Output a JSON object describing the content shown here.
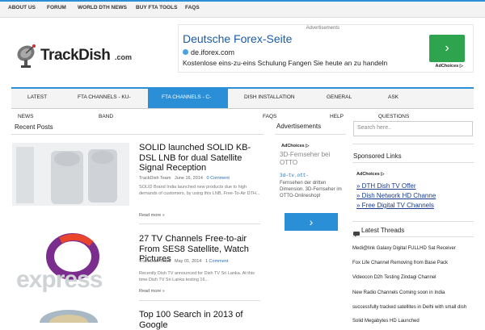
{
  "topnav": [
    "ABOUT US",
    "FORUM",
    "WORLD DTH NEWS",
    "BUY FTA TOOLS",
    "FAQS"
  ],
  "logo": {
    "name": "TrackDish",
    "suffix": ".com"
  },
  "top_ad": {
    "label": "Advertisements",
    "headline": "Deutsche Forex-Seite",
    "url": "de.iforex.com",
    "description": "Kostenlose eins-zu-eins Schulung Fangen Sie heute an zu handeln",
    "go": "›",
    "choices": "AdChoices ▷"
  },
  "mainnav": [
    "LATEST",
    "FTA CHANNELS - KU-",
    "FTA CHANNELS - C-",
    "DISH INSTALLATION",
    "GENERAL",
    "ASK"
  ],
  "mainnav_sub": [
    "NEWS",
    "BAND",
    "FAQS",
    "HELP",
    "QUESTIONS"
  ],
  "recent_posts_title": "Recent Posts",
  "posts": [
    {
      "title": "SOLID launched SOLID KB-DSL LNB for dual Satellite Signal Reception",
      "author": "TrackDish Team",
      "date": "June 16, 2014",
      "comments": "0 Comment",
      "excerpt": "SOLID Brand India launched new products due to high demands of customers, by using this LNB, Free-To-Air DTH...",
      "read_more": "Read more »"
    },
    {
      "title": "27 TV Channels Free-to-air From SES8 Satellite, Watch Pictures",
      "author": "TrackDish Team",
      "date": "May 01, 2014",
      "comments": "1 Comment",
      "excerpt": "Recently Dish TV announced for Dish TV Sri Lanka. At this time Dish TV Sri Lanka testing 16...",
      "read_more": "Read more »"
    },
    {
      "title": "Top 100 Search in 2013 of Google"
    }
  ],
  "thumb2_text": "express",
  "sidebar_ad": {
    "title": "Advertisements",
    "choices": "AdChoices ▷",
    "headline": "3D-Fernseher bei OTTO",
    "url": "3d-tv.ott-",
    "desc": "Fernsehen der dritten Dimension. 3D-Fernseher im OTTO-Onlineshop!",
    "go": "›"
  },
  "search": {
    "placeholder": "Search here.."
  },
  "sponsored": {
    "title": "Sponsored Links",
    "choices": "AdChoices ▷",
    "links": [
      "» DTH Dish TV Offer",
      "» Dish Network HD Channe",
      "» Free Digital TV Channels"
    ]
  },
  "threads": {
    "title": "Latest Threads",
    "items": [
      "Medi@link Galaxy Digital FULLHD Sat Receiver",
      "Fox Life Channel Removing from Base Pack",
      "Videocon D2h Testing Zindagi Channel",
      "New Radio Channels Coming soon in India",
      "successfully tracked satellites in Delhi with small dish",
      "Solid Megabytes HD Launched"
    ]
  },
  "colors": {
    "accent": "#2b8fd8",
    "ad_button": "#2ea44f",
    "link": "#1a5ba8"
  }
}
